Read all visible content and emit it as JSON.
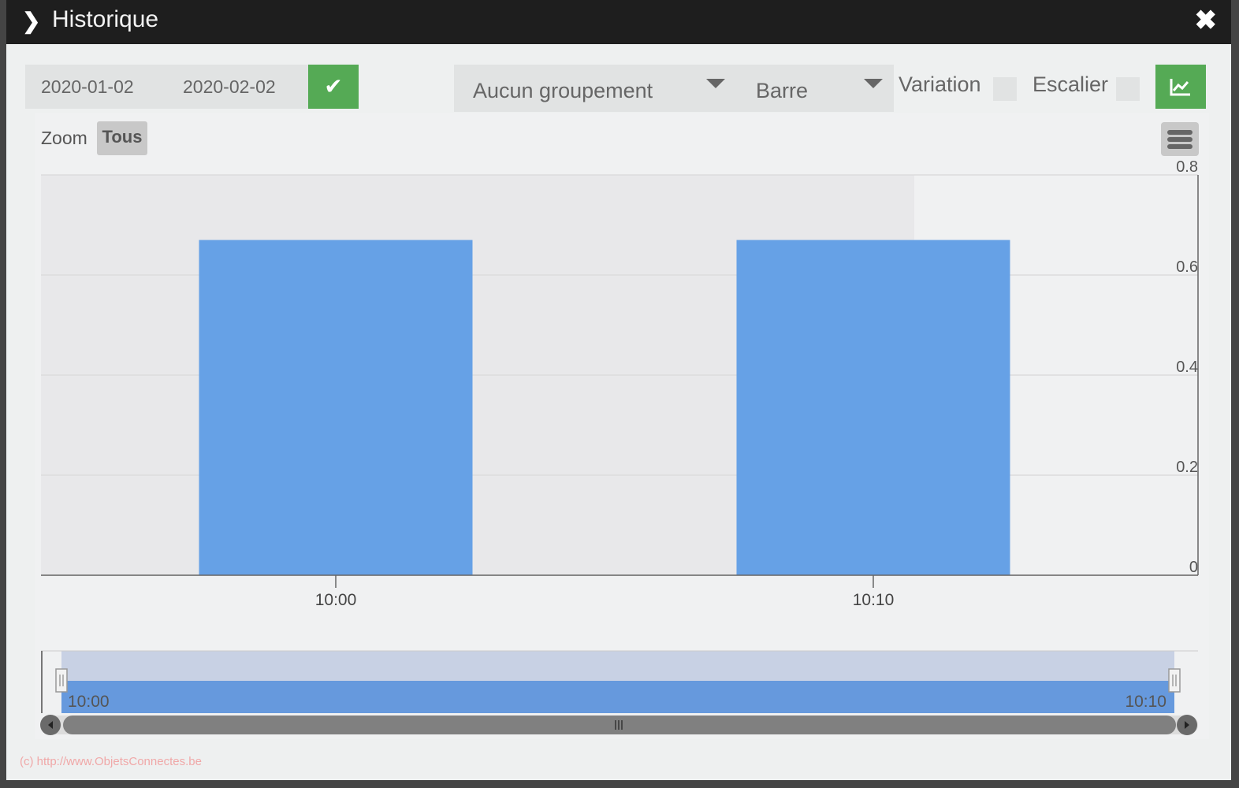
{
  "window": {
    "title": "Historique",
    "expand_icon": "chevron-right-icon",
    "close_icon": "close-icon"
  },
  "toolbar": {
    "start_date": "2020-01-02",
    "end_date": "2020-02-02",
    "apply_icon": "check-icon",
    "grouping": "Aucun groupement",
    "chart_type": "Barre",
    "variation_label": "Variation",
    "variation_checked": false,
    "stairs_label": "Escalier",
    "stairs_checked": false,
    "compare_icon": "chart-line-icon"
  },
  "chart": {
    "zoom_label": "Zoom",
    "zoom_all": "Tous",
    "menu_icon": "hamburger-menu-icon"
  },
  "chart_data": {
    "type": "bar",
    "categories": [
      "10:00",
      "10:10"
    ],
    "values": [
      0.67,
      0.67
    ],
    "ylim": [
      0,
      0.8
    ],
    "yticks": [
      "0",
      "0.2",
      "0.4",
      "0.6",
      "0.8"
    ],
    "xticks": [
      "10:00",
      "10:10"
    ],
    "grid": true,
    "yaxis_side": "right",
    "bar_color": "#66a1e6",
    "navigator": {
      "start_label": "10:00",
      "end_label": "10:10"
    }
  },
  "footer": "(c) http://www.ObjetsConnectes.be"
}
